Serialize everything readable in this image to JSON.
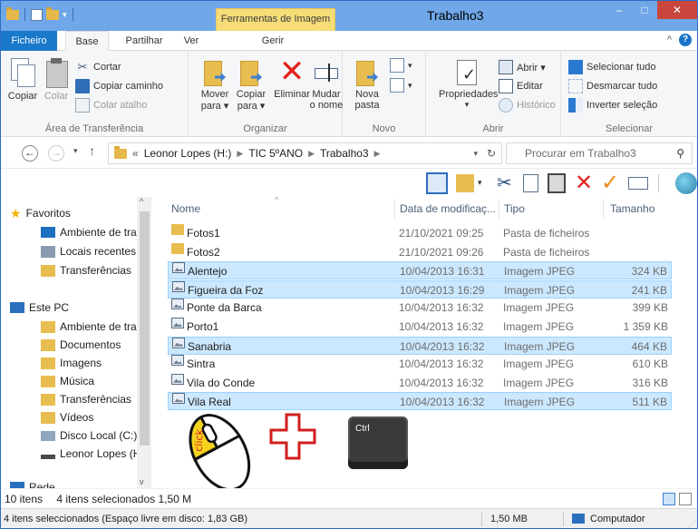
{
  "window": {
    "title": "Trabalho3",
    "context_tab": "Ferramentas de Imagem",
    "controls": {
      "minimize": "–",
      "maximize": "□",
      "close": "✕"
    }
  },
  "ribbon": {
    "tabs": [
      {
        "label": "Ficheiro"
      },
      {
        "label": "Base"
      },
      {
        "label": "Partilhar"
      },
      {
        "label": "Ver"
      },
      {
        "label": "Gerir"
      }
    ],
    "groups": {
      "clipboard": {
        "label": "Área de Transferência",
        "copiar": "Copiar",
        "colar": "Colar",
        "cortar": "Cortar",
        "copiar_caminho": "Copiar caminho",
        "colar_atalho": "Colar atalho"
      },
      "organizar": {
        "label": "Organizar",
        "mover": "Mover",
        "mover_sub": "para ▾",
        "copiar": "Copiar",
        "copiar_sub": "para ▾",
        "eliminar": "Eliminar",
        "mudar": "Mudar",
        "mudar_sub": "o nome"
      },
      "novo": {
        "label": "Novo",
        "nova": "Nova",
        "nova_sub": "pasta"
      },
      "abrir": {
        "label": "Abrir",
        "propriedades": "Propriedades",
        "abrir": "Abrir ▾",
        "editar": "Editar",
        "historico": "Histórico"
      },
      "selecionar": {
        "label": "Selecionar",
        "tudo": "Selecionar tudo",
        "desmarcar": "Desmarcar tudo",
        "inverter": "Inverter seleção"
      }
    }
  },
  "address": {
    "prefix": "«",
    "crumbs": [
      "Leonor Lopes (H:)",
      "TIC 5ºANO",
      "Trabalho3"
    ],
    "search_placeholder": "Procurar em Trabalho3"
  },
  "navpane": {
    "items": [
      {
        "label": "Favoritos",
        "icon": "star-icon"
      },
      {
        "label": "Ambiente de trab",
        "icon": "desktop-icon"
      },
      {
        "label": "Locais recentes",
        "icon": "recent-places-icon"
      },
      {
        "label": "Transferências",
        "icon": "downloads-icon"
      },
      {
        "label": "Este PC",
        "icon": "computer-icon"
      },
      {
        "label": "Ambiente de trab",
        "icon": "desktop-folder-icon"
      },
      {
        "label": "Documentos",
        "icon": "documents-icon"
      },
      {
        "label": "Imagens",
        "icon": "pictures-icon"
      },
      {
        "label": "Música",
        "icon": "music-icon"
      },
      {
        "label": "Transferências",
        "icon": "downloads-icon"
      },
      {
        "label": "Vídeos",
        "icon": "videos-icon"
      },
      {
        "label": "Disco Local (C:)",
        "icon": "local-disk-icon"
      },
      {
        "label": "Leonor Lopes (H:",
        "icon": "drive-icon"
      },
      {
        "label": "Rede",
        "icon": "network-icon"
      }
    ]
  },
  "filelist": {
    "columns": {
      "name": "Nome",
      "date": "Data de modificaç...",
      "type": "Tipo",
      "size": "Tamanho"
    },
    "rows": [
      {
        "name": "Fotos1",
        "date": "21/10/2021 09:25",
        "type": "Pasta de ficheiros",
        "size": "",
        "kind": "folder",
        "selected": false
      },
      {
        "name": "Fotos2",
        "date": "21/10/2021 09:26",
        "type": "Pasta de ficheiros",
        "size": "",
        "kind": "folder",
        "selected": false
      },
      {
        "name": "Alentejo",
        "date": "10/04/2013 16:31",
        "type": "Imagem JPEG",
        "size": "324 KB",
        "kind": "image",
        "selected": true
      },
      {
        "name": "Figueira da Foz",
        "date": "10/04/2013 16:29",
        "type": "Imagem JPEG",
        "size": "241 KB",
        "kind": "image",
        "selected": true
      },
      {
        "name": "Ponte da Barca",
        "date": "10/04/2013 16:32",
        "type": "Imagem JPEG",
        "size": "399 KB",
        "kind": "image",
        "selected": false
      },
      {
        "name": "Porto1",
        "date": "10/04/2013 16:32",
        "type": "Imagem JPEG",
        "size": "1 359 KB",
        "kind": "image",
        "selected": false
      },
      {
        "name": "Sanabria",
        "date": "10/04/2013 16:32",
        "type": "Imagem JPEG",
        "size": "464 KB",
        "kind": "image",
        "selected": true
      },
      {
        "name": "Sintra",
        "date": "10/04/2013 16:32",
        "type": "Imagem JPEG",
        "size": "610 KB",
        "kind": "image",
        "selected": false
      },
      {
        "name": "Vila do Conde",
        "date": "10/04/2013 16:32",
        "type": "Imagem JPEG",
        "size": "316 KB",
        "kind": "image",
        "selected": false
      },
      {
        "name": "Vila Real",
        "date": "10/04/2013 16:32",
        "type": "Imagem JPEG",
        "size": "511 KB",
        "kind": "image",
        "selected": true
      }
    ]
  },
  "status": {
    "items": "10 itens",
    "selected": "4 itens selecionados 1,50 M",
    "bottom_left": "4 itens seleccionados (Espaço livre em disco: 1,83 GB)",
    "bottom_size": "1,50 MB",
    "bottom_location": "Computador"
  },
  "overlay": {
    "mouse_label": "click",
    "key_label": "Ctrl",
    "plus_color": "#d21f1f"
  },
  "colors": {
    "titlebar": "#6fa7e8",
    "file_tab": "#1979ca",
    "context_tab": "#f6dd78",
    "selection": "#cce8ff",
    "selection_border": "#99d1ff"
  }
}
